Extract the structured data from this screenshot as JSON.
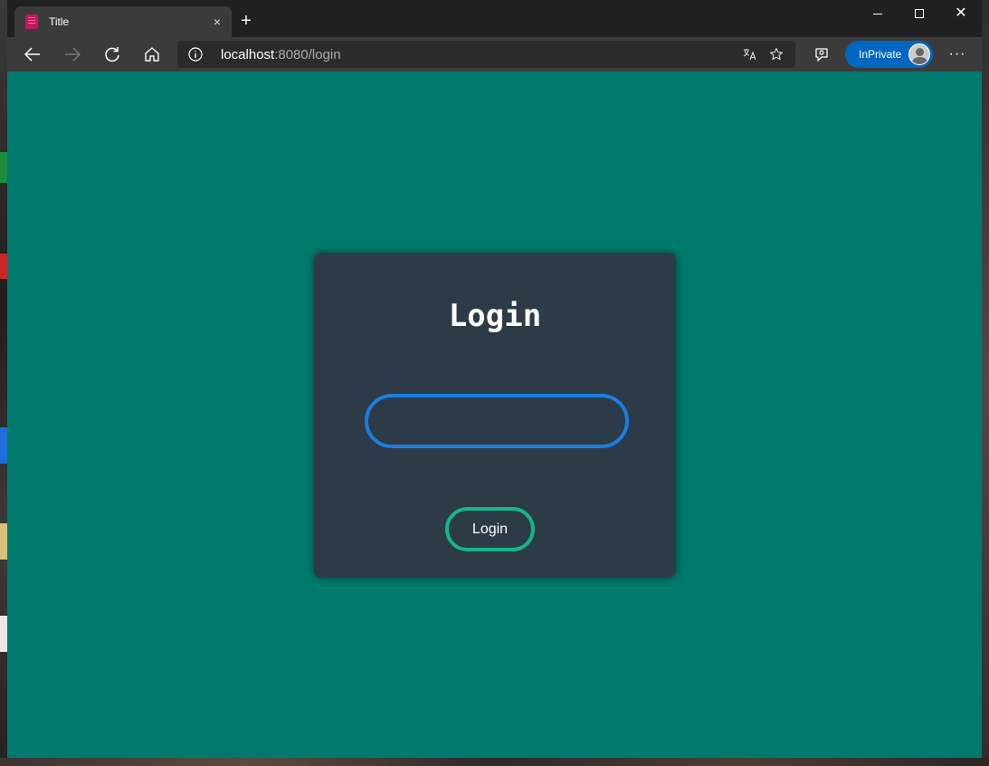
{
  "browser": {
    "tab": {
      "title": "Title",
      "close_symbol": "×"
    },
    "new_tab_symbol": "+",
    "window_controls": {
      "close_symbol": "✕"
    },
    "address": {
      "host": "localhost",
      "rest": ":8080/login"
    },
    "inprivate_label": "InPrivate",
    "more_symbol": "···",
    "icons": [
      "back-icon",
      "forward-icon",
      "refresh-icon",
      "home-icon",
      "info-icon",
      "read-aloud-icon",
      "favorite-star-icon",
      "immersive-reader-icon",
      "avatar-icon",
      "more-icon"
    ]
  },
  "login": {
    "title": "Login",
    "input_value": "",
    "button_label": "Login"
  },
  "colors": {
    "page_background": "#007a6c",
    "card_background": "#2d3a47",
    "input_border": "#1a7ee0",
    "button_border": "#17b38e",
    "inprivate_badge": "#0067c0"
  }
}
